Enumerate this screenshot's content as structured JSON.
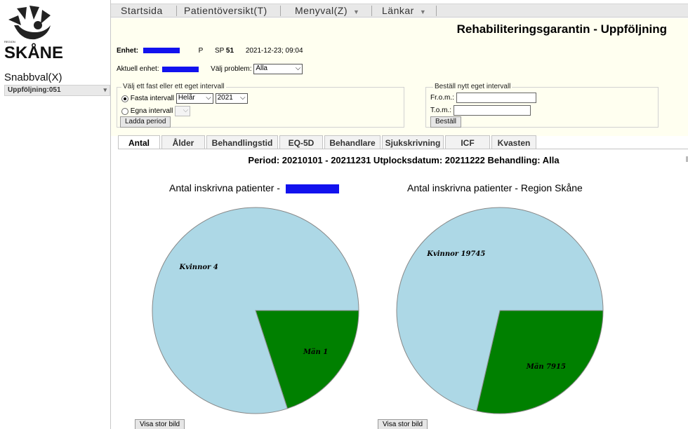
{
  "sidebar": {
    "logo_word": "SKÅNE",
    "logo_region": "REGION",
    "snabbval_label": "Snabbval(X)",
    "snabbval_value": "Uppföljning:051"
  },
  "menu": {
    "items": [
      "Startsida",
      "Patientöversikt(T)",
      "Menyval(Z)",
      "Länkar"
    ]
  },
  "header": {
    "title": "Rehabiliteringsgarantin - Uppföljning",
    "enhet_label": "Enhet:",
    "p_label": "P",
    "sp_label": "SP",
    "sp_value": "51",
    "timestamp": "2021-12-23; 09:04"
  },
  "filters": {
    "aktuell_enhet_label": "Aktuell enhet:",
    "valj_problem_label": "Välj problem:",
    "valj_problem_value": "Alla",
    "interval_legend": "Välj ett fast eller ett eget intervall",
    "fasta_label": "Fasta intervall",
    "fasta_period_value": "Helår",
    "fasta_year_value": "2021",
    "egna_label": "Egna intervall",
    "ladda_button": "Ladda period",
    "bestall_legend": "Beställ nytt eget intervall",
    "from_label": "Fr.o.m.:",
    "tom_label": "T.o.m.:",
    "bestall_button": "Beställ"
  },
  "tabs": [
    "Antal",
    "Ålder",
    "Behandlingstid",
    "EQ-5D",
    "Behandlare",
    "Sjukskrivning",
    "ICF",
    "Kvasten"
  ],
  "active_tab": "Antal",
  "content": {
    "period_text": "Period: 20210101 - 20211231   Utplocksdatum: 20211222   Behandling: Alla",
    "chart_left_title": "Antal inskrivna patienter -",
    "chart_right_title": "Antal inskrivna patienter - Region Skåne",
    "visa_button": "Visa stor bild"
  },
  "colors": {
    "kvinnor": "#add8e6",
    "man": "#008000",
    "header_bg": "#fffff0",
    "redaction": "#1212ee"
  },
  "chart_data": [
    {
      "type": "pie",
      "title": "Antal inskrivna patienter -",
      "categories": [
        "Kvinnor",
        "Män"
      ],
      "values": [
        4,
        1
      ],
      "labels": [
        "Kvinnor 4",
        "Män 1"
      ]
    },
    {
      "type": "pie",
      "title": "Antal inskrivna patienter - Region Skåne",
      "categories": [
        "Kvinnor",
        "Män"
      ],
      "values": [
        19745,
        7915
      ],
      "labels": [
        "Kvinnor 19745",
        "Män 7915"
      ]
    }
  ]
}
